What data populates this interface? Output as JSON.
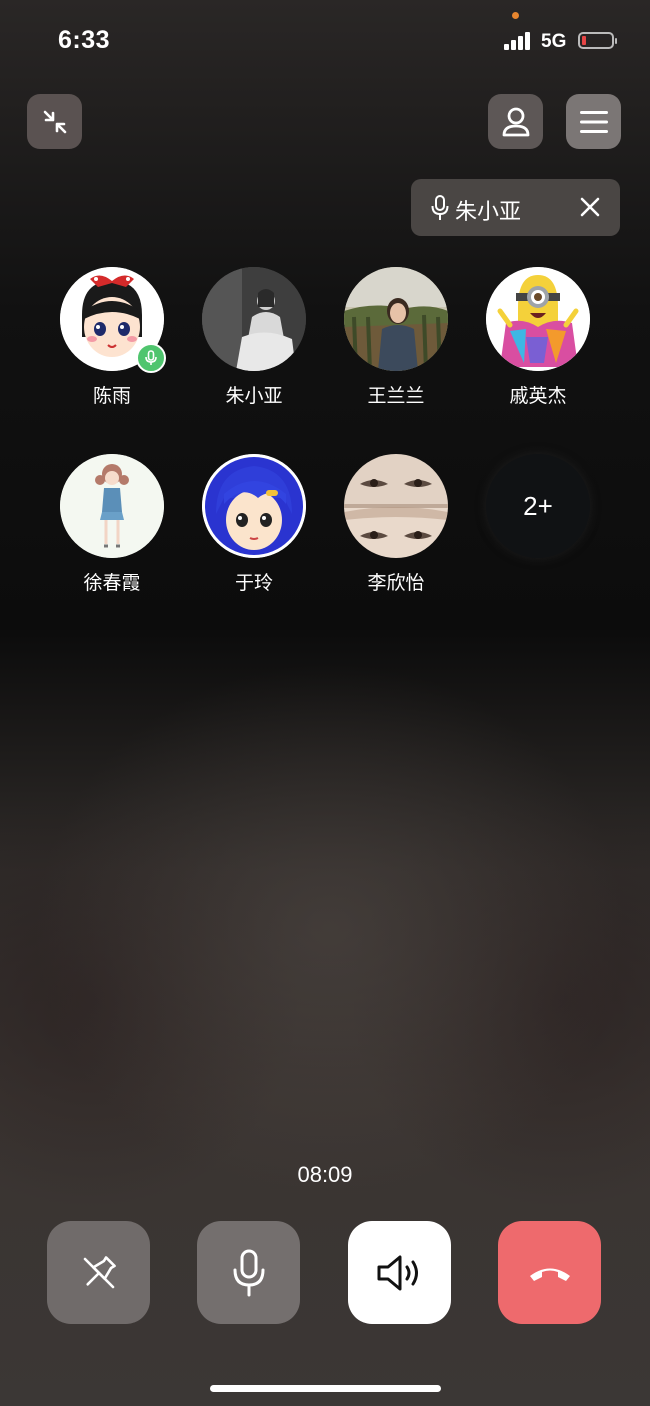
{
  "status_bar": {
    "time": "6:33",
    "network": "5G",
    "battery_level": 0.1,
    "battery_color": "#e54545",
    "signal_bars": 4
  },
  "top_controls": {
    "minimize_icon": "minimize-arrows-icon",
    "contact_icon": "person-icon",
    "menu_icon": "hamburger-menu-icon"
  },
  "speaking_indicator": {
    "icon": "microphone-icon",
    "name": "朱小亚",
    "close_icon": "close-icon"
  },
  "participants": [
    {
      "name": "陈雨",
      "speaking": true
    },
    {
      "name": "朱小亚",
      "speaking": false
    },
    {
      "name": "王兰兰",
      "speaking": false
    },
    {
      "name": "戚英杰",
      "speaking": false
    },
    {
      "name": "徐春霞",
      "speaking": false
    },
    {
      "name": "于玲",
      "speaking": false
    },
    {
      "name": "李欣怡",
      "speaking": false
    }
  ],
  "more_participants": "2+",
  "call_timer": "08:09",
  "controls": {
    "pin_icon": "pin-off-icon",
    "mic_icon": "microphone-icon",
    "speaker_icon": "speaker-icon",
    "hangup_icon": "phone-hangup-icon",
    "hangup_color": "#ee6a6d"
  }
}
